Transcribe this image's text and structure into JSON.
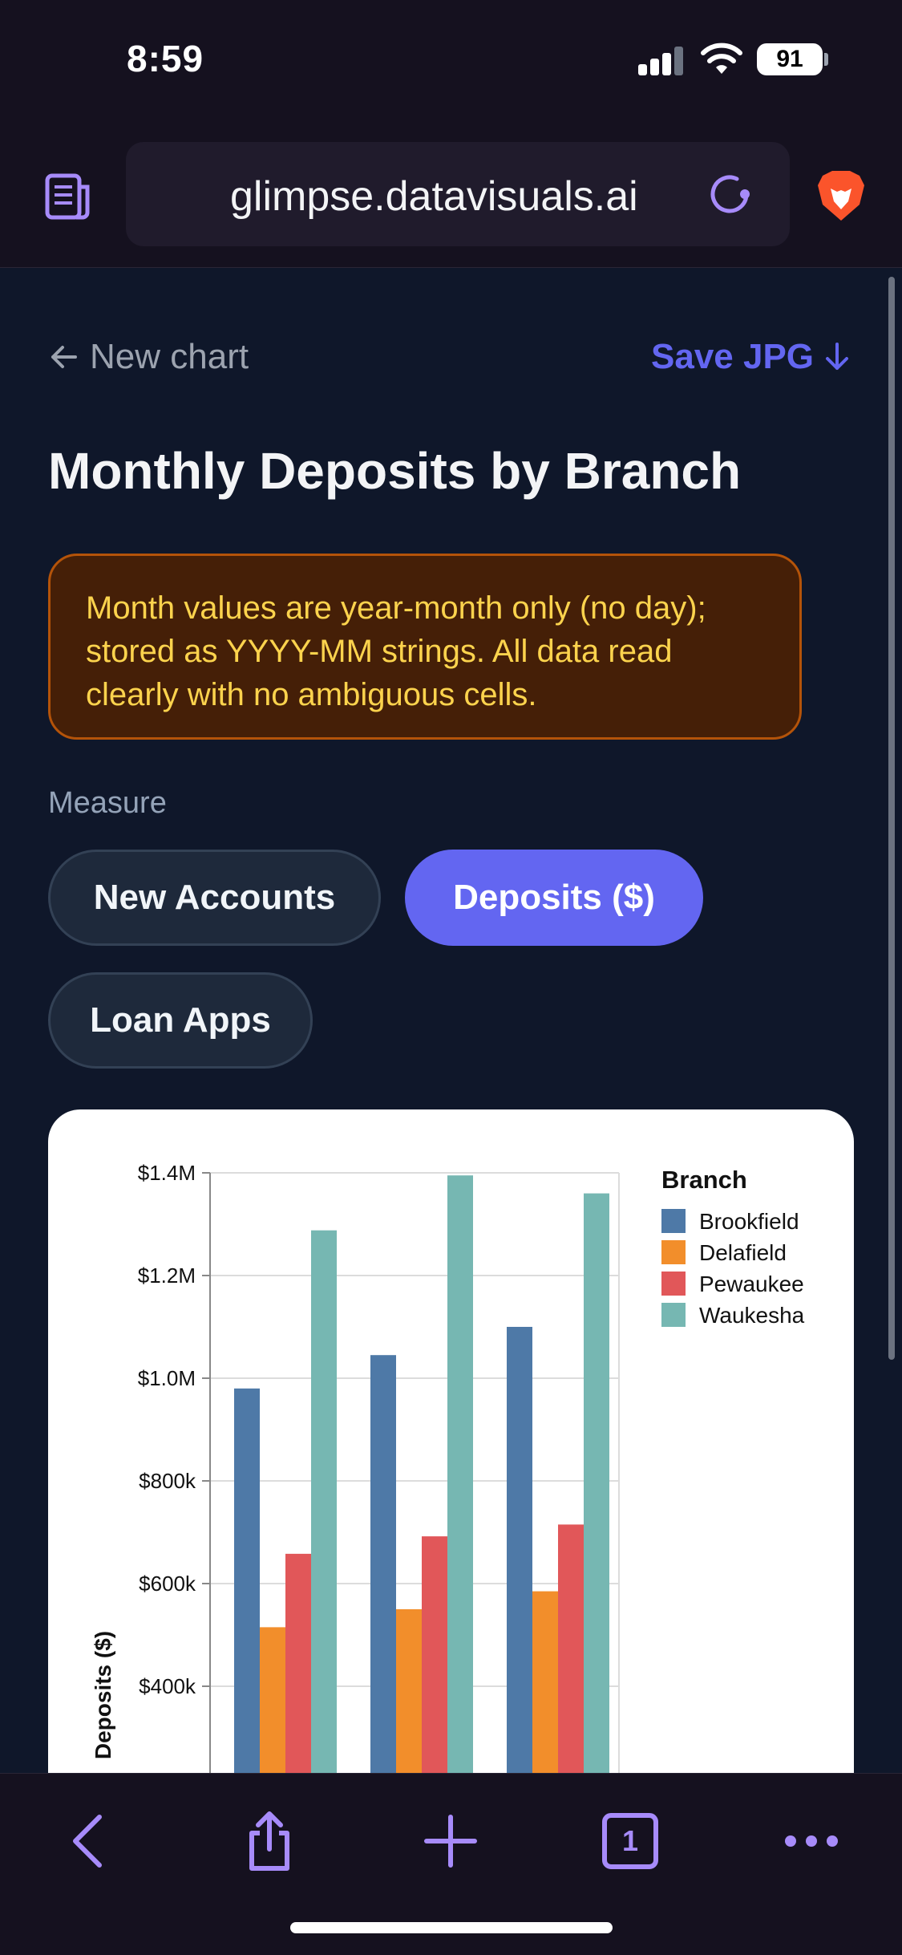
{
  "status_bar": {
    "time": "8:59",
    "battery": "91"
  },
  "browser": {
    "url": "glimpse.datavisuals.ai",
    "icons": [
      "reader-mode-icon",
      "reload-icon",
      "brave-lion-icon"
    ],
    "toolbar": [
      "back-icon",
      "share-icon",
      "new-tab-icon",
      "tabs-icon",
      "more-icon"
    ],
    "tab_count": "1"
  },
  "page": {
    "back_label": "New chart",
    "save_label": "Save JPG",
    "title": "Monthly Deposits by Branch",
    "note": "Month values are year-month only (no day); stored as YYYY-MM strings. All data read clearly with no ambiguous cells.",
    "measure_label": "Measure",
    "measures": [
      "New Accounts",
      "Deposits ($)",
      "Loan Apps"
    ],
    "selected_measure": "Deposits ($)"
  },
  "colors": {
    "accent": "#6366f1",
    "Brookfield": "#4e79a7",
    "Delafield": "#f28e2b",
    "Pewaukee": "#e15759",
    "Waukesha": "#76b7b2"
  },
  "chart_data": {
    "type": "bar",
    "categories": [
      "",
      "",
      ""
    ],
    "ylabel": "Deposits ($)",
    "ytick_labels": [
      "$400k",
      "$600k",
      "$800k",
      "$1.0M",
      "$1.2M",
      "$1.4M"
    ],
    "ytick_values": [
      400000,
      600000,
      800000,
      1000000,
      1200000,
      1400000
    ],
    "ylim": [
      250000,
      1400000
    ],
    "legend_title": "Branch",
    "legend_position": "top-right",
    "grid": true,
    "series": [
      {
        "name": "Brookfield",
        "values": [
          980000,
          1045000,
          1100000
        ]
      },
      {
        "name": "Delafield",
        "values": [
          515000,
          550000,
          585000
        ]
      },
      {
        "name": "Pewaukee",
        "values": [
          658000,
          692000,
          715000
        ]
      },
      {
        "name": "Waukesha",
        "values": [
          1288000,
          1395000,
          1360000
        ]
      }
    ]
  }
}
